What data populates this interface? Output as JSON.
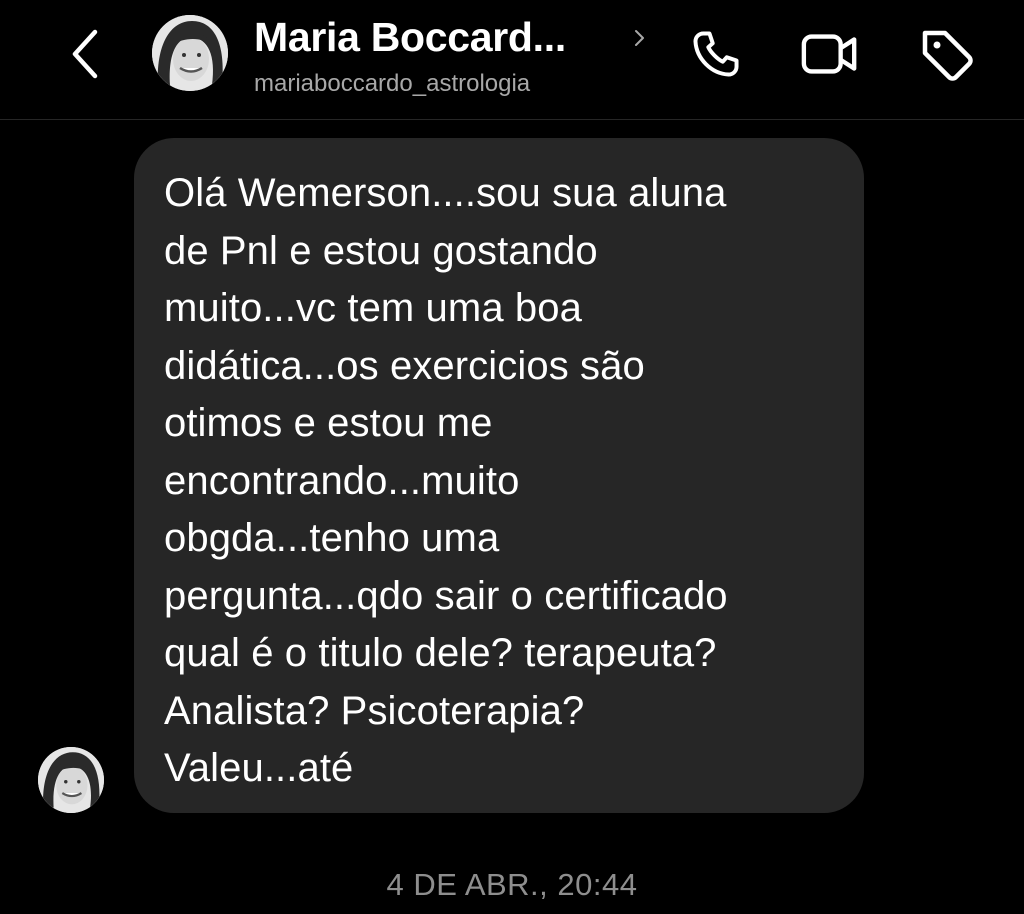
{
  "header": {
    "back_icon": "chevron-left-icon",
    "contact_name": "Maria Boccard...",
    "contact_handle": "mariaboccardo_astrologia",
    "profile_chevron_icon": "chevron-right-icon",
    "actions": [
      {
        "icon": "phone-icon"
      },
      {
        "icon": "video-camera-icon"
      },
      {
        "icon": "tag-icon"
      }
    ]
  },
  "messages": [
    {
      "direction": "incoming",
      "text": "Olá Wemerson....sou sua aluna\nde Pnl e estou gostando\nmuito...vc tem uma boa\ndidática...os exercicios são\notimos e estou me\nencontrando...muito\nobgda...tenho uma\npergunta...qdo sair o certificado\nqual é o titulo dele? terapeuta?\nAnalista? Psicoterapia?\nValeu...até"
    }
  ],
  "timestamp": "4 DE ABR., 20:44",
  "colors": {
    "background": "#000000",
    "bubble": "#262626",
    "text": "#ffffff",
    "secondary_text": "#a8a8a8",
    "timestamp": "#8e8e8e"
  }
}
